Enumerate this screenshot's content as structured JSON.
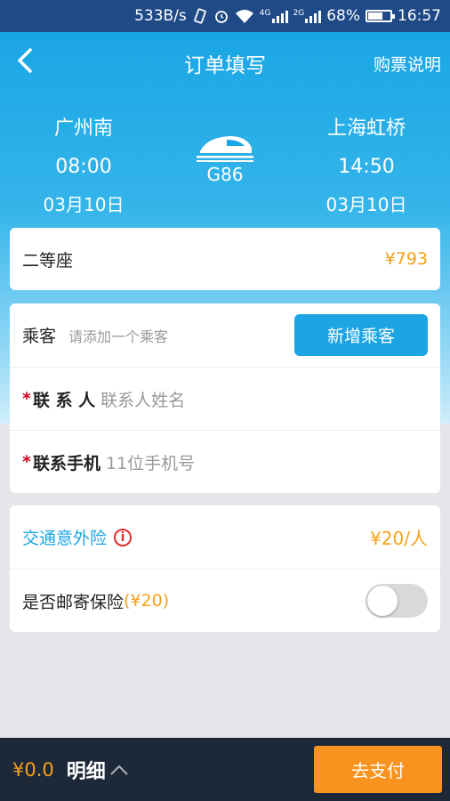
{
  "status_bar": {
    "speed": "533B/s",
    "network_4g": "4G",
    "network_2g": "2G",
    "battery_percent": "68%",
    "battery_level": 0.68,
    "time": "16:57"
  },
  "nav": {
    "title": "订单填写",
    "right_label": "购票说明"
  },
  "trip": {
    "from_station": "广州南",
    "from_time": "08:00",
    "from_date": "03月10日",
    "train_no": "G86",
    "to_station": "上海虹桥",
    "to_time": "14:50",
    "to_date": "03月10日"
  },
  "seat": {
    "type": "二等座",
    "price": "¥793"
  },
  "passenger": {
    "label": "乘客",
    "hint": "请添加一个乘客",
    "add_button": "新增乘客",
    "contact_label": "联 系 人",
    "contact_placeholder": "联系人姓名",
    "phone_label": "联系手机",
    "phone_placeholder": "11位手机号",
    "required_mark": "*"
  },
  "insurance": {
    "label": "交通意外险",
    "info_glyph": "i",
    "price": "¥20/人",
    "mail_label": "是否邮寄保险",
    "mail_price": "(¥20)",
    "mail_enabled": false
  },
  "bottom": {
    "total": "¥0.0",
    "detail_label": "明细",
    "pay_button": "去支付"
  },
  "colors": {
    "accent_blue": "#1ca4e3",
    "price_orange": "#f5a11b",
    "required_red": "#d0021b",
    "bottom_bg": "#1d2838",
    "pay_orange": "#f7931e"
  }
}
